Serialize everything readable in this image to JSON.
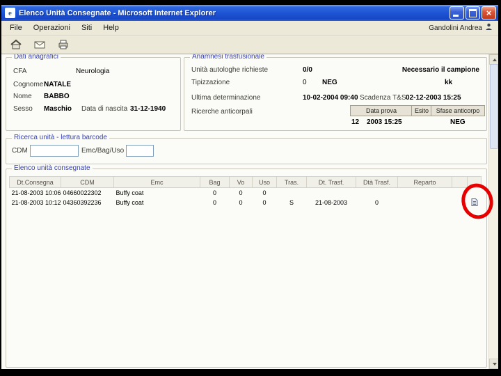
{
  "colors": {
    "annotation_red": "#e60000"
  },
  "window": {
    "title": "Elenco Unità Consegnate - Microsoft Internet Explorer"
  },
  "menubar": {
    "items": [
      "File",
      "Operazioni",
      "Siti",
      "Help"
    ],
    "user": "Gandolini Andrea"
  },
  "patient": {
    "legend": "Dati anagrafici",
    "cfa_label": "CFA",
    "cfa_value": "Neurologia",
    "cognome_label": "Cognome",
    "cognome_value": "NATALE",
    "nome_label": "Nome",
    "nome_value": "BABBO",
    "sesso_label": "Sesso",
    "sesso_value": "Maschio",
    "nascita_label": "Data di nascita",
    "nascita_value": "31-12-1940"
  },
  "anamnesi": {
    "legend": "Anamnesi trasfusionale",
    "autologhe_label": "Unità autologhe richieste",
    "autologhe_value": "0/0",
    "campione": "Necessario il campione",
    "tipizzazione_label": "Tipizzazione",
    "tipizzazione_value": "0",
    "tipizzazione_esito": "NEG",
    "fenotipo": "kk",
    "ultima_label": "Ultima determinazione",
    "ultima_value": "10-02-2004 09:40",
    "scadenza_label": "Scadenza T&S",
    "scadenza_value": "02-12-2003 15:25",
    "ricerche_label": "Ricerche anticorpali",
    "buttons": [
      "Data prova",
      "Esito",
      "Sfase anticorpo"
    ],
    "riga": [
      "12",
      "2003 15:25",
      "NEG"
    ]
  },
  "barcode": {
    "legend": "Ricerca unità - lettura barcode",
    "cdm_label": "CDM",
    "cdm_value": "",
    "emc_label": "Emc/Bag/Uso",
    "emc_value": ""
  },
  "elenco": {
    "legend": "Elenco unità consegnate",
    "headers": [
      "Dt.Consegna",
      "CDM",
      "Emc",
      "Bag",
      "Vo",
      "Uso",
      "Tras.",
      "Dt. Trasf.",
      "Dtà Trasf.",
      "Reparto",
      "",
      ""
    ],
    "rows": [
      [
        "21-08-2003 10:06",
        "04660022302",
        "Buffy coat",
        "0",
        "0",
        "0",
        "",
        "",
        "",
        "",
        "",
        ""
      ],
      [
        "21-08-2003 10:12",
        "04360392236",
        "Buffy coat",
        "0",
        "0",
        "0",
        "S",
        "21-08-2003",
        "0",
        "",
        "",
        ""
      ]
    ]
  }
}
